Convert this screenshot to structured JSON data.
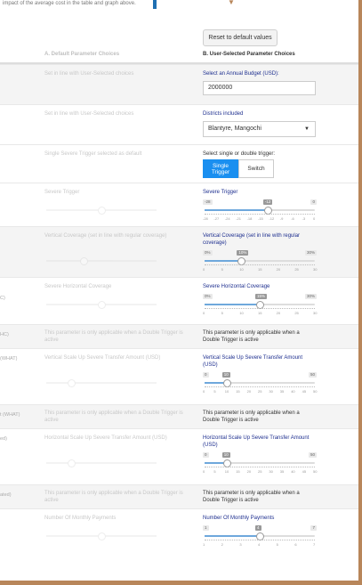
{
  "intro_text": "impact of the average cost in the table and graph above.",
  "reset_label": "Reset to default values",
  "headers": {
    "a": "A. Default Parameter Choices",
    "b": "B. User-Selected Parameter Choices"
  },
  "rows": {
    "budget": {
      "a_desc": "Set in line with User-Selected choices",
      "b_label": "Select an Annual Budget (USD):",
      "b_value": "2000000"
    },
    "districts": {
      "a_desc": "Set in line with User-Selected choices",
      "b_label": "Districts included",
      "b_value": "Blantyre, Mangochi"
    },
    "trigger": {
      "a_desc": "Single Severe Trigger selected as default",
      "b_label": "Select single or double trigger:",
      "single": "Single Trigger",
      "switch": "Switch"
    },
    "severe_trigger": {
      "a_desc": "Severe Trigger",
      "b_label": "Severe Trigger",
      "min": "-28",
      "max": "0",
      "current": "-12",
      "current_value": -12,
      "range": [
        -28,
        0
      ],
      "tick_labels": [
        "-28",
        "-27",
        "-24",
        "-21",
        "-18",
        "-15",
        "-12",
        "-9",
        "-6",
        "-3",
        "0"
      ]
    },
    "vertical_coverage": {
      "a_desc": "Vertical Coverage (set in line with regular coverage)",
      "b_label": "Vertical Coverage (set in line with regular coverage)",
      "min": "0%",
      "max": "30%",
      "current": "10%",
      "current_value": 10,
      "range": [
        0,
        30
      ],
      "tick_labels": [
        "0",
        "5",
        "10",
        "15",
        "20",
        "25",
        "30"
      ]
    },
    "horizontal_coverage": {
      "param": "C)",
      "a_desc": "Severe Horizontal Coverage",
      "b_label": "Severe Horizontal Coverage",
      "min": "0%",
      "max": "30%",
      "current": "15%",
      "current_value": 15,
      "range": [
        0,
        30
      ],
      "tick_labels": [
        "0",
        "5",
        "10",
        "15",
        "20",
        "25",
        "30"
      ]
    },
    "double_1": {
      "param": "HC)",
      "a_desc": "This parameter is only applicable when a Double Trigger is active",
      "b_text": "This parameter is only applicable when a Double Trigger is active"
    },
    "vertical_scale": {
      "param": "(WHAT)",
      "a_desc": "Vertical Scale Up Severe Transfer Amount (USD)",
      "b_label": "Vertical Scale Up Severe Transfer Amount (USD)",
      "min": "0",
      "max": "50",
      "current": "10",
      "current_value": 10,
      "range": [
        0,
        50
      ],
      "tick_labels": [
        "0",
        "5",
        "10",
        "15",
        "20",
        "25",
        "30",
        "35",
        "40",
        "45",
        "50"
      ]
    },
    "double_2": {
      "param": "t (WHAT)",
      "a_desc": "This parameter is only applicable when a Double Trigger is active",
      "b_text": "This parameter is only applicable when a Double Trigger is active"
    },
    "horizontal_scale": {
      "param": "ed)",
      "a_desc": "Horizontal Scale Up Severe Transfer Amount (USD)",
      "b_label": "Horizontal Scale Up Severe Transfer Amount (USD)",
      "min": "0",
      "max": "50",
      "current": "10",
      "current_value": 10,
      "range": [
        0,
        50
      ],
      "tick_labels": [
        "0",
        "5",
        "10",
        "15",
        "20",
        "25",
        "30",
        "35",
        "40",
        "45",
        "50"
      ]
    },
    "double_3": {
      "param": "ated)",
      "a_desc": "This parameter is only applicable when a Double Trigger is active",
      "b_text": "This parameter is only applicable when a Double Trigger is active"
    },
    "monthly_payments": {
      "a_desc": "Number Of Monthly Payments",
      "b_label": "Number Of Monthly Payments",
      "min": "1",
      "max": "7",
      "current": "4",
      "current_value": 4,
      "range": [
        1,
        7
      ],
      "tick_labels": [
        "1",
        "2",
        "3",
        "4",
        "5",
        "6",
        "7"
      ]
    }
  }
}
